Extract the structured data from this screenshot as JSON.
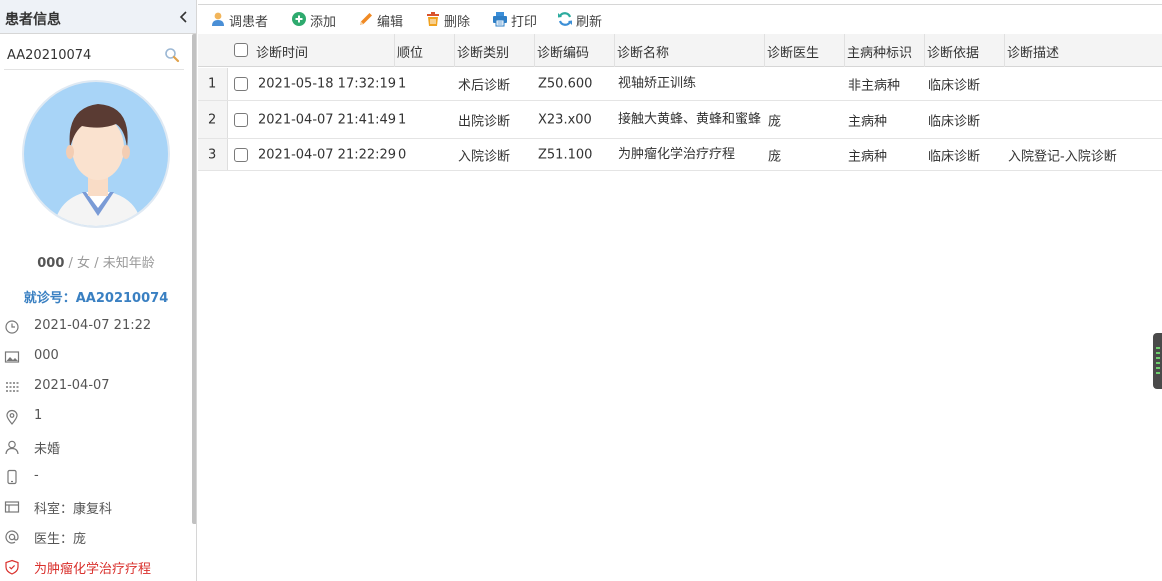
{
  "left_panel": {
    "title": "患者信息",
    "search_value": "AA20210074",
    "patient_id": "000",
    "patient_sep1": " / ",
    "patient_gender": "女",
    "patient_sep2": " / ",
    "patient_age": "未知年龄",
    "visit_label": "就诊号：AA20210074",
    "info": {
      "admit_time": "2021-04-07 21:22",
      "photo_value": "000",
      "date": "2021-04-07",
      "location": "1",
      "marital": "未婚",
      "phone": "-",
      "department": "科室：康复科",
      "doctor": "医生：庞",
      "diagnosis": "为肿瘤化学治疗疗程"
    }
  },
  "toolbar": {
    "patient_btn": "调患者",
    "add_btn": "添加",
    "edit_btn": "编辑",
    "delete_btn": "删除",
    "print_btn": "打印",
    "refresh_btn": "刷新"
  },
  "grid": {
    "columns": {
      "time": "诊断时间",
      "order": "顺位",
      "type": "诊断类别",
      "code": "诊断编码",
      "name": "诊断名称",
      "doctor": "诊断医生",
      "main_flag": "主病种标识",
      "basis": "诊断依据",
      "desc": "诊断描述"
    },
    "rows": [
      {
        "num": "1",
        "time": "2021-05-18 17:32:19",
        "order": "1",
        "type": "术后诊断",
        "code": "Z50.600",
        "name": "视轴矫正训练",
        "doctor": "",
        "main_flag": "非主病种",
        "basis": "临床诊断",
        "desc": ""
      },
      {
        "num": "2",
        "time": "2021-04-07 21:41:49",
        "order": "1",
        "type": "出院诊断",
        "code": "X23.x00",
        "name": "接触大黄蜂、黄蜂和蜜蜂",
        "doctor": "庞",
        "main_flag": "主病种",
        "basis": "临床诊断",
        "desc": ""
      },
      {
        "num": "3",
        "time": "2021-04-07 21:22:29",
        "order": "0",
        "type": "入院诊断",
        "code": "Z51.100",
        "name": "为肿瘤化学治疗疗程",
        "doctor": "庞",
        "main_flag": "主病种",
        "basis": "临床诊断",
        "desc": "入院登记-入院诊断"
      }
    ]
  },
  "colors": {
    "accent": "#3a80c2",
    "warning": "#d9302c"
  }
}
